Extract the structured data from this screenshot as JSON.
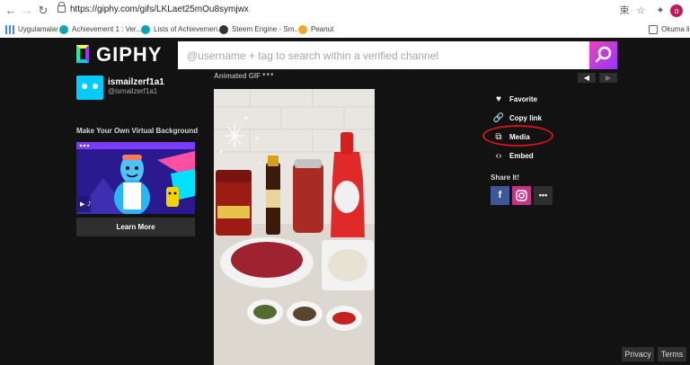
{
  "browser": {
    "url": "https://giphy.com/gifs/LKLaet25mOu8symjwx",
    "profile_initial": "o",
    "bookmarks": [
      {
        "label": "Uygulamalar",
        "color": "#4285f4"
      },
      {
        "label": "Achievement 1 : Ver...",
        "color": "#0ca5b0"
      },
      {
        "label": "Lists of Achievemen...",
        "color": "#0ca5b0"
      },
      {
        "label": "Steem Engine - Sm...",
        "color": "#333333"
      },
      {
        "label": "Peanut",
        "color": "#f5a623"
      }
    ],
    "reading_list": "Okuma list"
  },
  "header": {
    "logo": "GIPHY",
    "search_placeholder": "@username + tag to search within a verified channel"
  },
  "user": {
    "name": "ismailzerf1a1",
    "handle": "@ismailzerf1a1"
  },
  "promo": {
    "title": "Make Your Own Virtual Background",
    "button": "Learn More"
  },
  "gif": {
    "label": "Animated GIF",
    "more": "•••"
  },
  "actions": {
    "favorite": "Favorite",
    "copy_link": "Copy link",
    "media": "Media",
    "embed": "Embed"
  },
  "share": {
    "title": "Share It!",
    "facebook": "f",
    "more": "•••"
  },
  "footer": {
    "privacy": "Privacy",
    "terms": "Terms"
  },
  "colors": {
    "background": "#121212",
    "search_gradient": "#9933ff",
    "facebook": "#3b5998",
    "instagram": "#c13584",
    "highlight_circle": "#d0141c"
  }
}
